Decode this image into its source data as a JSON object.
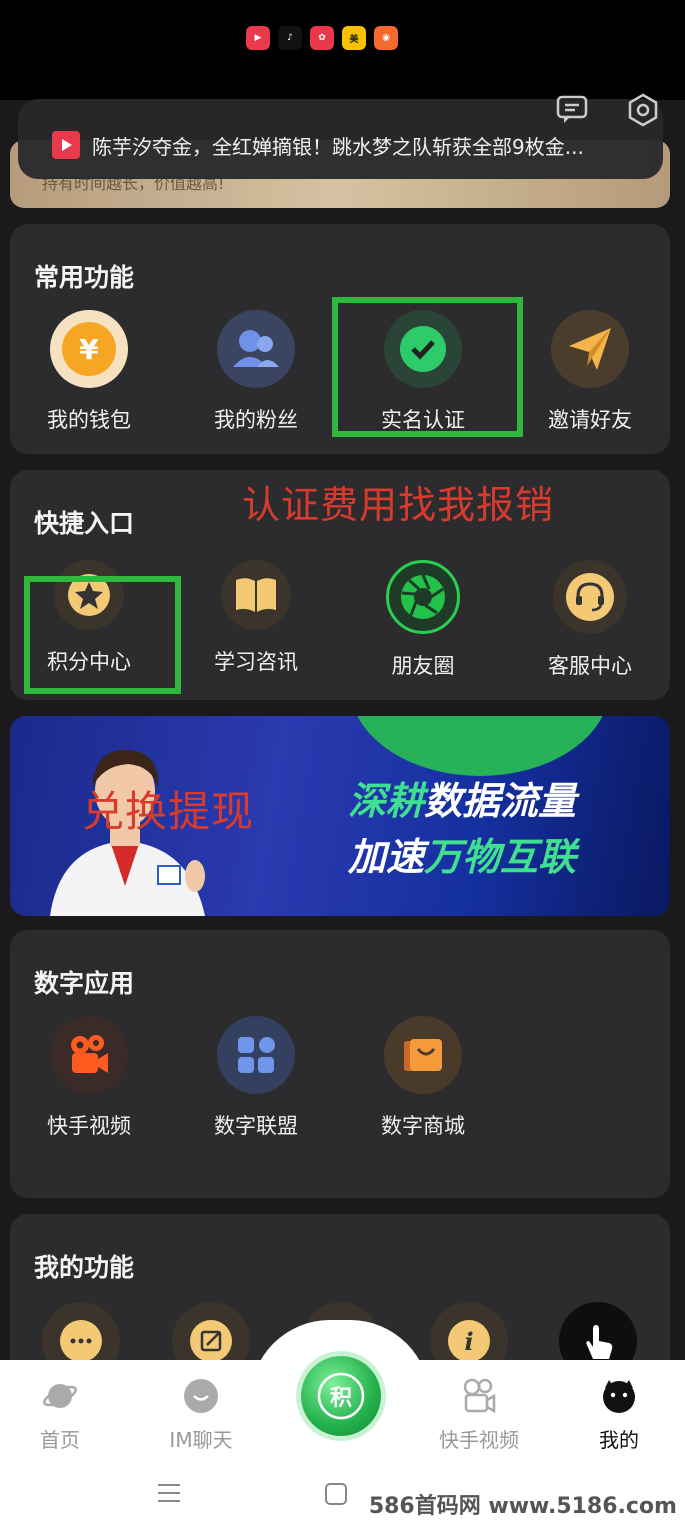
{
  "status_apps": [
    "video",
    "douyin",
    "app3",
    "美团",
    "app5"
  ],
  "gold_card_text": "持有时间越长，价值越高!",
  "news": {
    "text": "陈芋汐夺金，全红婵摘银！跳水梦之队斩获全部9枚金..."
  },
  "common": {
    "title": "常用功能",
    "items": [
      {
        "label": "我的钱包",
        "icon": "yuan-icon"
      },
      {
        "label": "我的粉丝",
        "icon": "users-icon"
      },
      {
        "label": "实名认证",
        "icon": "check-icon"
      },
      {
        "label": "邀请好友",
        "icon": "paper-plane-icon"
      }
    ]
  },
  "overlay_text_1": "认证费用找我报销",
  "quick": {
    "title": "快捷入口",
    "items": [
      {
        "label": "积分中心",
        "icon": "star-icon"
      },
      {
        "label": "学习咨讯",
        "icon": "book-icon"
      },
      {
        "label": "朋友圈",
        "icon": "aperture-icon"
      },
      {
        "label": "客服中心",
        "icon": "headset-icon"
      }
    ]
  },
  "banner": {
    "line1_a": "深耕",
    "line1_b": "数据流量",
    "line2_a": "加速",
    "line2_b": "万物互联"
  },
  "overlay_text_2": "兑换提现",
  "digital": {
    "title": "数字应用",
    "items": [
      {
        "label": "快手视频",
        "icon": "video-camera-icon"
      },
      {
        "label": "数字联盟",
        "icon": "grid-icon"
      },
      {
        "label": "数字商城",
        "icon": "shopping-bag-icon"
      }
    ]
  },
  "mine": {
    "title": "我的功能"
  },
  "nav": {
    "items": [
      {
        "label": "首页"
      },
      {
        "label": "IM聊天"
      },
      {
        "label": "快手视频"
      },
      {
        "label": "我的"
      }
    ],
    "center_label": "积"
  },
  "watermark": "586首码网 www.5186.com"
}
